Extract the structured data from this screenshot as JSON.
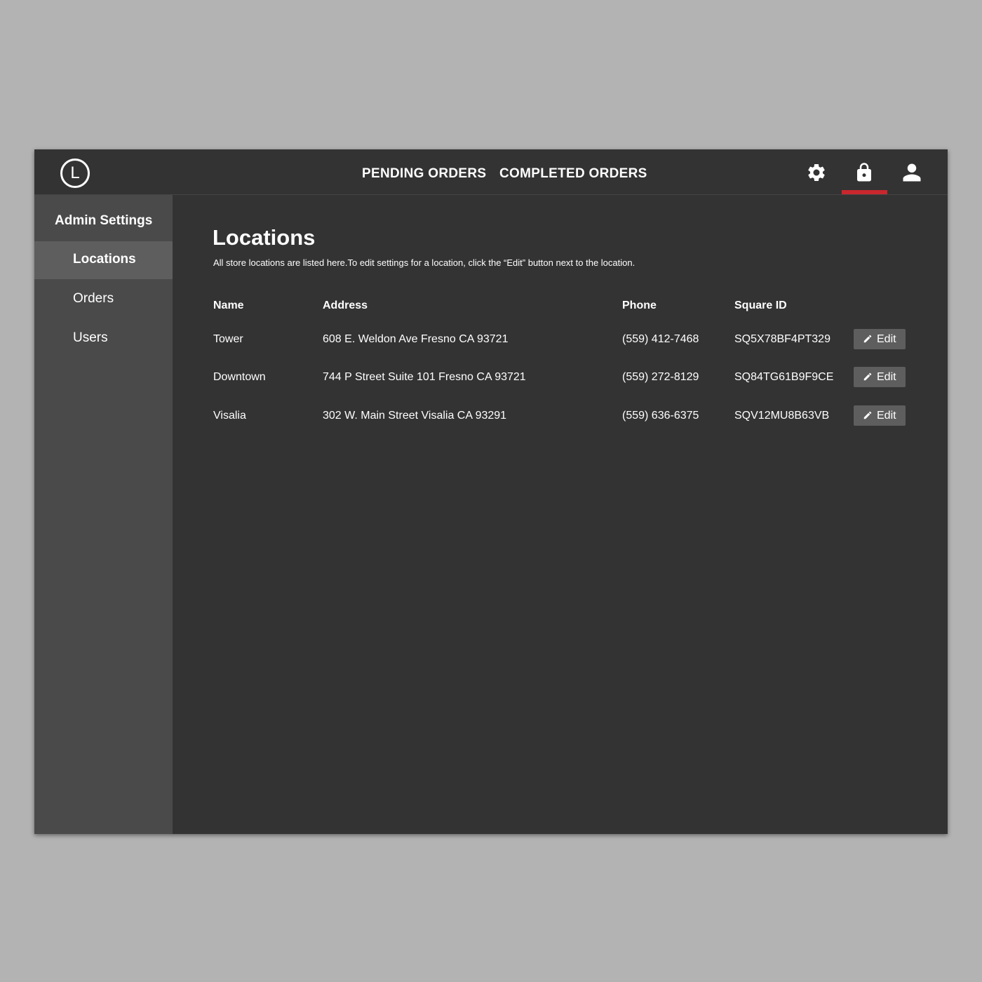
{
  "app": {
    "logo_letter": "L"
  },
  "topnav": {
    "tabs": [
      {
        "label": "PENDING ORDERS"
      },
      {
        "label": "COMPLETED ORDERS"
      }
    ],
    "icons": [
      "gear-icon",
      "lock-icon",
      "user-icon"
    ],
    "active_icon": "lock-icon",
    "accent_color": "#c8272d"
  },
  "sidebar": {
    "header": "Admin Settings",
    "items": [
      {
        "label": "Locations",
        "active": true
      },
      {
        "label": "Orders",
        "active": false
      },
      {
        "label": "Users",
        "active": false
      }
    ]
  },
  "main": {
    "title": "Locations",
    "description": "All store locations are listed here.To edit settings for a location, click the “Edit” button next to the location.",
    "table": {
      "headers": [
        "Name",
        "Address",
        "Phone",
        "Square ID"
      ],
      "rows": [
        {
          "name": "Tower",
          "address": "608 E. Weldon Ave Fresno CA 93721",
          "phone": "(559) 412-7468",
          "square_id": "SQ5X78BF4PT329",
          "action": "Edit"
        },
        {
          "name": "Downtown",
          "address": "744 P Street Suite 101 Fresno CA 93721",
          "phone": "(559) 272-8129",
          "square_id": "SQ84TG61B9F9CE",
          "action": "Edit"
        },
        {
          "name": "Visalia",
          "address": "302 W. Main Street Visalia CA 93291",
          "phone": "(559) 636-6375",
          "square_id": "SQV12MU8B63VB",
          "action": "Edit"
        }
      ]
    }
  }
}
